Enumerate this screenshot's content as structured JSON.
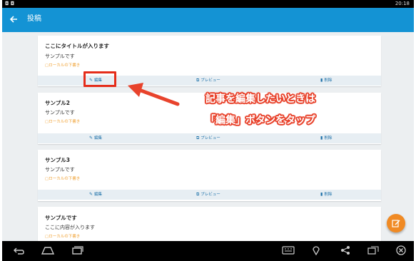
{
  "status_bar": {
    "time": "20:18"
  },
  "app_bar": {
    "title": "投稿"
  },
  "cards": [
    {
      "title": "ここにタイトルが入ります",
      "body": "サンプルです",
      "note": "ローカルの下書き"
    },
    {
      "title": "サンプル2",
      "body": "サンプルです",
      "note": "ローカルの下書き"
    },
    {
      "title": "サンプル3",
      "body": "サンプルです",
      "note": "ローカルの下書き"
    },
    {
      "title": "サンプルです",
      "body": "ここに内容が入ります",
      "note": "ローカルの下書き"
    }
  ],
  "actions": {
    "edit": "編集",
    "preview": "プレビュー",
    "delete": "削除"
  },
  "annotation": {
    "line1": "記事を編集したいときは",
    "line2": "「編集」ボタンをタップ"
  },
  "colors": {
    "app_bar": "#1493d4",
    "fab": "#f08a24",
    "highlight": "#e52d1a",
    "note": "#f0a030"
  }
}
